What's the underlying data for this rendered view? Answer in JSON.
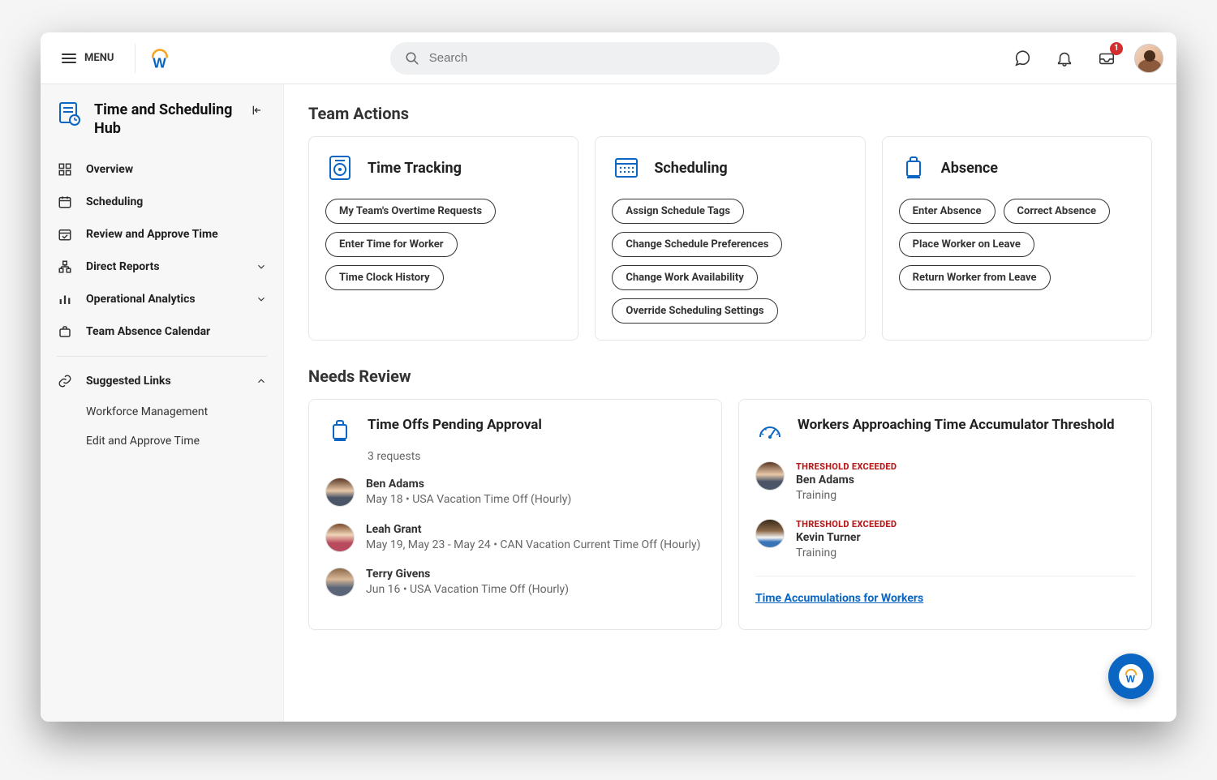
{
  "topbar": {
    "menu_label": "MENU",
    "search_placeholder": "Search",
    "inbox_badge": "1"
  },
  "sidebar": {
    "title": "Time and Scheduling Hub",
    "nav": [
      {
        "label": "Overview"
      },
      {
        "label": "Scheduling"
      },
      {
        "label": "Review and Approve Time"
      },
      {
        "label": "Direct Reports",
        "expandable": true
      },
      {
        "label": "Operational Analytics",
        "expandable": true
      },
      {
        "label": "Team Absence Calendar"
      }
    ],
    "suggested_title": "Suggested Links",
    "suggested": [
      {
        "label": "Workforce Management"
      },
      {
        "label": "Edit and Approve Time"
      }
    ]
  },
  "team_actions": {
    "title": "Team Actions",
    "cards": [
      {
        "title": "Time Tracking",
        "pills": [
          "My Team's Overtime Requests",
          "Enter Time for Worker",
          "Time Clock History"
        ]
      },
      {
        "title": "Scheduling",
        "pills": [
          "Assign Schedule Tags",
          "Change Schedule Preferences",
          "Change Work Availability",
          "Override Scheduling Settings"
        ]
      },
      {
        "title": "Absence",
        "pills": [
          "Enter Absence",
          "Correct Absence",
          "Place Worker on Leave",
          "Return Worker from Leave"
        ]
      }
    ]
  },
  "needs_review": {
    "title": "Needs Review",
    "timeoffs": {
      "title": "Time Offs Pending Approval",
      "sub": "3 requests",
      "people": [
        {
          "name": "Ben Adams",
          "detail": "May 18 • USA Vacation Time Off (Hourly)"
        },
        {
          "name": "Leah Grant",
          "detail": "May 19, May 23 - May 24 • CAN Vacation Current Time Off (Hourly)"
        },
        {
          "name": "Terry Givens",
          "detail": "Jun 16 • USA Vacation Time Off (Hourly)"
        }
      ]
    },
    "threshold": {
      "title": "Workers Approaching Time Accumulator Threshold",
      "badge": "THRESHOLD EXCEEDED",
      "people": [
        {
          "name": "Ben Adams",
          "detail": "Training"
        },
        {
          "name": "Kevin Turner",
          "detail": "Training"
        }
      ],
      "footer_link": "Time Accumulations for Workers"
    }
  }
}
